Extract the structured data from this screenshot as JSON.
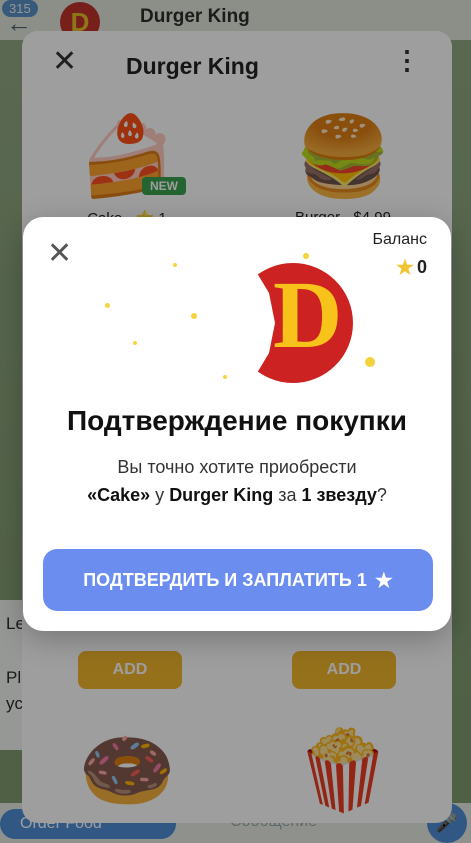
{
  "telegram": {
    "unread_count": "315",
    "chat_title": "Durger King",
    "avatar_letter": "D",
    "order_button": "Order Food",
    "message_placeholder": "Сообщение",
    "left_bubble_lines": [
      "Le",
      "Pl",
      "yc"
    ]
  },
  "webapp": {
    "title": "Durger King",
    "items": [
      {
        "emoji": "🍰",
        "caption": "Cake · ⭐ 1",
        "badge": "NEW"
      },
      {
        "emoji": "🍔",
        "caption": "Burger · $4.99"
      },
      {
        "emoji": "🍩",
        "caption": ""
      },
      {
        "emoji": "🍿",
        "caption": ""
      }
    ],
    "add_label": "ADD"
  },
  "dialog": {
    "balance_label": "Баланс",
    "balance_value": "0",
    "logo_letter": "D",
    "title": "Подтверждение покупки",
    "text_line1": "Вы точно хотите приобрести",
    "text_item": "«Cake»",
    "text_mid": " у ",
    "text_shop": "Durger King",
    "text_for": " за ",
    "text_amount": "1 звезду",
    "text_end": "?",
    "confirm_label": "ПОДТВЕРДИТЬ И ЗАПЛАТИТЬ 1"
  },
  "colors": {
    "accent_blue": "#6b8df0",
    "add_yellow": "#f3b62e",
    "brand_red": "#cc2222",
    "brand_yellow": "#f7c21a",
    "new_green": "#3aa24f"
  }
}
